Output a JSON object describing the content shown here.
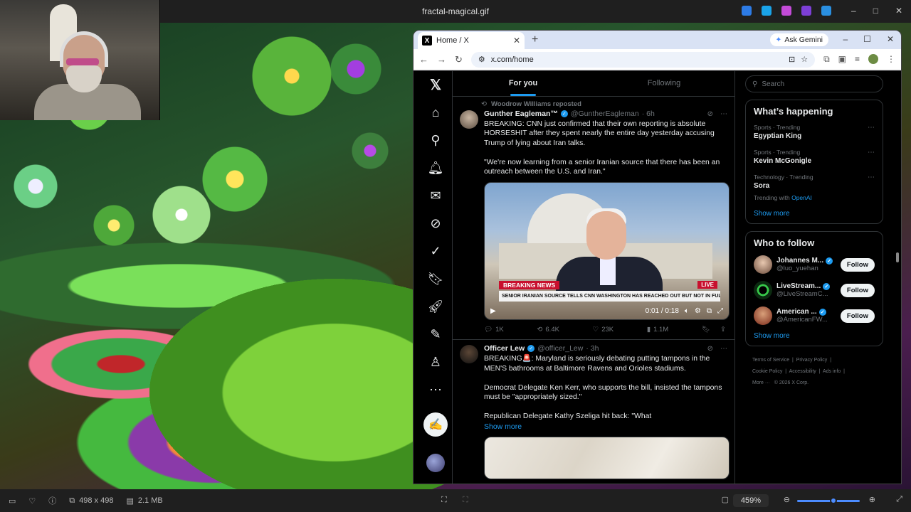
{
  "viewer": {
    "title": "fractal-magical.gif",
    "dimensions": "498 x 498",
    "size": "2.1 MB",
    "zoom": "459%"
  },
  "browser": {
    "tab_title": "Home / X",
    "tab_favicon": "X",
    "gemini_label": "Ask Gemini",
    "url": "x.com/home"
  },
  "x": {
    "tabs": {
      "for_you": "For you",
      "following": "Following"
    },
    "posts": [
      {
        "repost_by": "Woodrow Williams reposted",
        "name": "Gunther Eagleman™",
        "handle": "@GuntherEagleman",
        "time": "· 6h",
        "text": "BREAKING: CNN just confirmed that their own reporting is absolute HORSESHIT after they spent nearly the entire day yesterday accusing Trump of lying about Iran talks.\n\n\"We're now learning from a senior Iranian source that there has been an outreach between the U.S. and Iran.\"",
        "video": {
          "breaking": "BREAKING NEWS",
          "live": "LIVE",
          "chyron": "SENIOR IRANIAN SOURCE TELLS CNN WASHINGTON HAS REACHED OUT BUT NOT IN FULL NEGOTIATIONS",
          "time": "0:01 / 0:18"
        },
        "replies": "1K",
        "reposts": "6.4K",
        "likes": "23K",
        "views": "1.1M"
      },
      {
        "name": "Officer Lew",
        "handle": "@officer_Lew",
        "time": "· 3h",
        "text": "BREAKING🚨: Maryland is seriously debating putting tampons in the MEN'S bathrooms at Baltimore Ravens and Orioles stadiums.\n\nDemocrat Delegate Ken Kerr, who supports the bill, insisted the tampons must be \"appropriately sized.\"\n\nRepublican Delegate Kathy Szeliga hit back: \"What",
        "show_more": "Show more"
      }
    ],
    "sidebar": {
      "search_placeholder": "Search",
      "happening_title": "What’s happening",
      "trends": [
        {
          "context": "Sports · Trending",
          "title": "Egyptian King"
        },
        {
          "context": "Sports · Trending",
          "title": "Kevin McGonigle"
        },
        {
          "context": "Technology · Trending",
          "title": "Sora",
          "with_prefix": "Trending with",
          "with": "OpenAI"
        }
      ],
      "show_more": "Show more",
      "who_title": "Who to follow",
      "follows": [
        {
          "name": "Johannes M...",
          "handle": "@luo_yuehan",
          "button": "Follow"
        },
        {
          "name": "LiveStream...",
          "handle": "@LiveStreamC...",
          "button": "Follow"
        },
        {
          "name": "American ...",
          "handle": "@AmericanFW...",
          "button": "Follow"
        }
      ],
      "show_more_2": "Show more",
      "footer": {
        "terms": "Terms of Service",
        "privacy": "Privacy Policy",
        "cookie": "Cookie Policy",
        "accessibility": "Accessibility",
        "ads": "Ads info",
        "more": "More ···",
        "copyright": "© 2026 X Corp."
      }
    }
  },
  "colors": {
    "accent": "#1d9bf0",
    "background": "#000000"
  }
}
